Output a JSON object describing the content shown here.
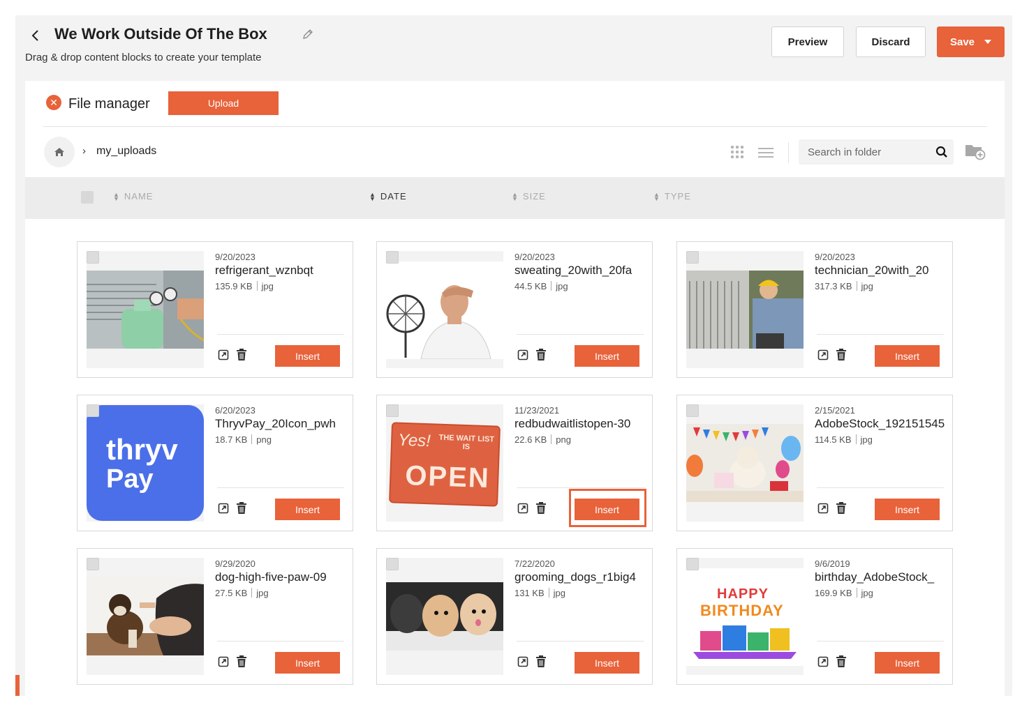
{
  "header": {
    "title": "We Work Outside Of The Box",
    "subtitle": "Drag & drop content blocks to create your template",
    "preview_label": "Preview",
    "discard_label": "Discard",
    "save_label": "Save"
  },
  "file_manager": {
    "title": "File manager",
    "upload_label": "Upload",
    "breadcrumb": "my_uploads",
    "search_placeholder": "Search in folder"
  },
  "columns": {
    "name": "NAME",
    "date": "DATE",
    "size": "SIZE",
    "type": "TYPE"
  },
  "colors": {
    "accent": "#e8623a",
    "thryv_blue": "#4a6fe8"
  },
  "files": [
    {
      "date": "9/20/2023",
      "name": "refrigerant_wznbqt",
      "size": "135.9 KB",
      "type": "jpg",
      "insert": "Insert"
    },
    {
      "date": "9/20/2023",
      "name": "sweating_20with_20fa",
      "size": "44.5 KB",
      "type": "jpg",
      "insert": "Insert"
    },
    {
      "date": "9/20/2023",
      "name": "technician_20with_20",
      "size": "317.3 KB",
      "type": "jpg",
      "insert": "Insert"
    },
    {
      "date": "6/20/2023",
      "name": "ThryvPay_20Icon_pwh",
      "size": "18.7 KB",
      "type": "png",
      "insert": "Insert",
      "thumb_text_1": "thryv",
      "thumb_text_2": "Pay"
    },
    {
      "date": "11/23/2021",
      "name": "redbudwaitlistopen-30",
      "size": "22.6 KB",
      "type": "png",
      "insert": "Insert",
      "thumb_text_1": "Yes!",
      "thumb_text_2": "THE WAIT LIST IS",
      "thumb_text_3": "OPEN"
    },
    {
      "date": "2/15/2021",
      "name": "AdobeStock_192151545",
      "size": "114.5 KB",
      "type": "jpg",
      "insert": "Insert"
    },
    {
      "date": "9/29/2020",
      "name": "dog-high-five-paw-09",
      "size": "27.5 KB",
      "type": "jpg",
      "insert": "Insert"
    },
    {
      "date": "7/22/2020",
      "name": "grooming_dogs_r1big4",
      "size": "131 KB",
      "type": "jpg",
      "insert": "Insert"
    },
    {
      "date": "9/6/2019",
      "name": "birthday_AdobeStock_",
      "size": "169.9 KB",
      "type": "jpg",
      "insert": "Insert",
      "thumb_text_1": "HAPPY",
      "thumb_text_2": "BIRTHDAY"
    }
  ]
}
